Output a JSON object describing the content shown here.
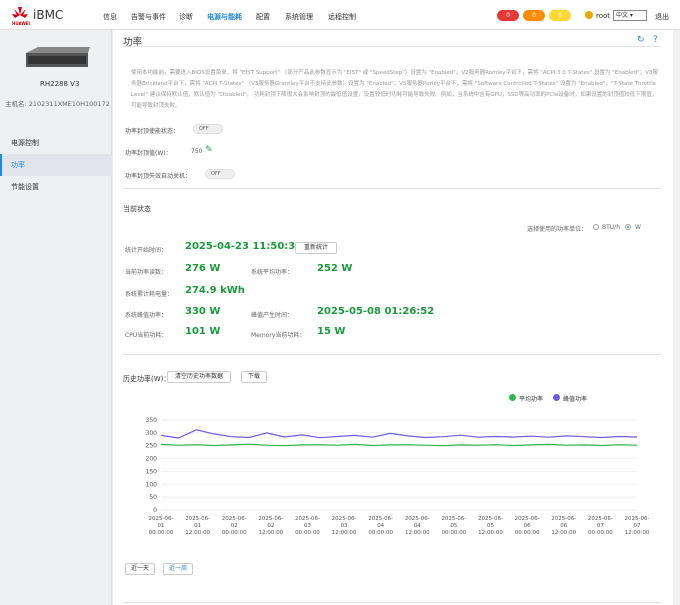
{
  "header": {
    "logo_text": "HUAWEI",
    "app_name": "iBMC",
    "nav": [
      "信息",
      "告警与事件",
      "诊断",
      "电源与能耗",
      "配置",
      "系统管理",
      "远程控制"
    ],
    "badges": [
      {
        "count": "0",
        "color": "#e53935"
      },
      {
        "count": "0",
        "color": "#fb8c00"
      },
      {
        "count": "0",
        "color": "#fdd835"
      }
    ],
    "user": "root",
    "language": "中文",
    "logout": "退出"
  },
  "sidebar": {
    "model": "RH2288 V3",
    "host": "主机名: 2102311XME10H1001720",
    "items": [
      "电源控制",
      "功率",
      "节能设置"
    ]
  },
  "page": {
    "title": "功率",
    "description": "使用本功能前，需要进入BIOS设置菜单，将 \"EIST Support\" （部分产品此参数显示为 \"EIST\" 或 \"SpeedStep\"）设置为 \"Enabled\"；V2服务器Romley平台下，需将 \"ACPI 3.0 T-States\" 设置为 \"Enabled\"；V3服务器Brickland平台下，需将 \"ACPI T-States\" （V3服务器Grantley平台不支持此参数）设置为 \"Enabled\"；V5服务器Purley平台下，需将 \"Software Controlled T-States\" 设置为 \"Enabled\"，\"T-State Throttle Level\" 建议保持默认值，默认值为 \"Disabled\"。 功耗封顶下降很大会影响封顶的最低值设置，设置较低时功耗可能导致失败。例如，当系统中含有GPU，SSD等高功率的PCIe设备时，如果设置的封顶值较低下限值，可能导致封顶失败。",
    "capping_enable_label": "功率封顶使能状态：",
    "capping_enable_state": "OFF",
    "capping_value_label": "功率封顶值(W)：",
    "capping_value": "750",
    "capping_fail_label": "功率封顶失效自动关机：",
    "capping_fail_state": "OFF"
  },
  "status": {
    "title": "当前状态",
    "unit_label": "选择使用的功率单位：",
    "unit_options": [
      "BTU/h",
      "W"
    ],
    "start_time_label": "统计开始时间：",
    "start_time": "2025-04-23 11:50:31",
    "reset_button": "重新统计",
    "current_power_label": "当前功率读数：",
    "current_power": "276 W",
    "avg_power_label": "系统平均功率：",
    "avg_power": "252 W",
    "total_energy_label": "系统累计耗电量：",
    "total_energy": "274.9 kWh",
    "peak_power_label": "系统峰值功率：",
    "peak_power": "330 W",
    "peak_time_label": "峰值产生时间：",
    "peak_time": "2025-05-08 01:26:52",
    "cpu_power_label": "CPU当前功耗：",
    "cpu_power": "101 W",
    "memory_power_label": "Memory当前功耗：",
    "memory_power": "15 W"
  },
  "history": {
    "title": "历史功率(W)：",
    "clear_button": "清空历史功率数据",
    "download_button": "下载",
    "range_buttons": [
      "近一天",
      "近一周"
    ]
  },
  "chart_data": {
    "type": "line",
    "ylim": [
      0,
      350
    ],
    "yticks": [
      0,
      50,
      100,
      150,
      200,
      250,
      300,
      350
    ],
    "xticks": [
      "2025-06-01 00:00:00",
      "2025-06-01 12:00:00",
      "2025-06-02 00:00:00",
      "2025-06-02 12:00:00",
      "2025-06-03 00:00:00",
      "2025-06-03 12:00:00",
      "2025-06-04 00:00:00",
      "2025-06-04 12:00:00",
      "2025-06-05 00:00:00",
      "2025-06-05 12:00:00",
      "2025-06-06 00:00:00",
      "2025-06-06 12:00:00",
      "2025-06-07 00:00:00",
      "2025-06-07 12:00:00"
    ],
    "series": [
      {
        "name": "平均功率",
        "color": "#2eb84f",
        "values": [
          255,
          252,
          254,
          251,
          253,
          256,
          252,
          250,
          253,
          254,
          252,
          255,
          251,
          253,
          254,
          252,
          250,
          253,
          252,
          254,
          251,
          253,
          255,
          252,
          253,
          251,
          254,
          252
        ]
      },
      {
        "name": "峰值功率",
        "color": "#6c5ce7",
        "values": [
          290,
          280,
          312,
          296,
          285,
          282,
          300,
          284,
          292,
          281,
          286,
          290,
          283,
          298,
          288,
          282,
          285,
          291,
          283,
          286,
          284,
          287,
          283,
          288,
          285,
          282,
          286,
          284
        ]
      }
    ]
  }
}
